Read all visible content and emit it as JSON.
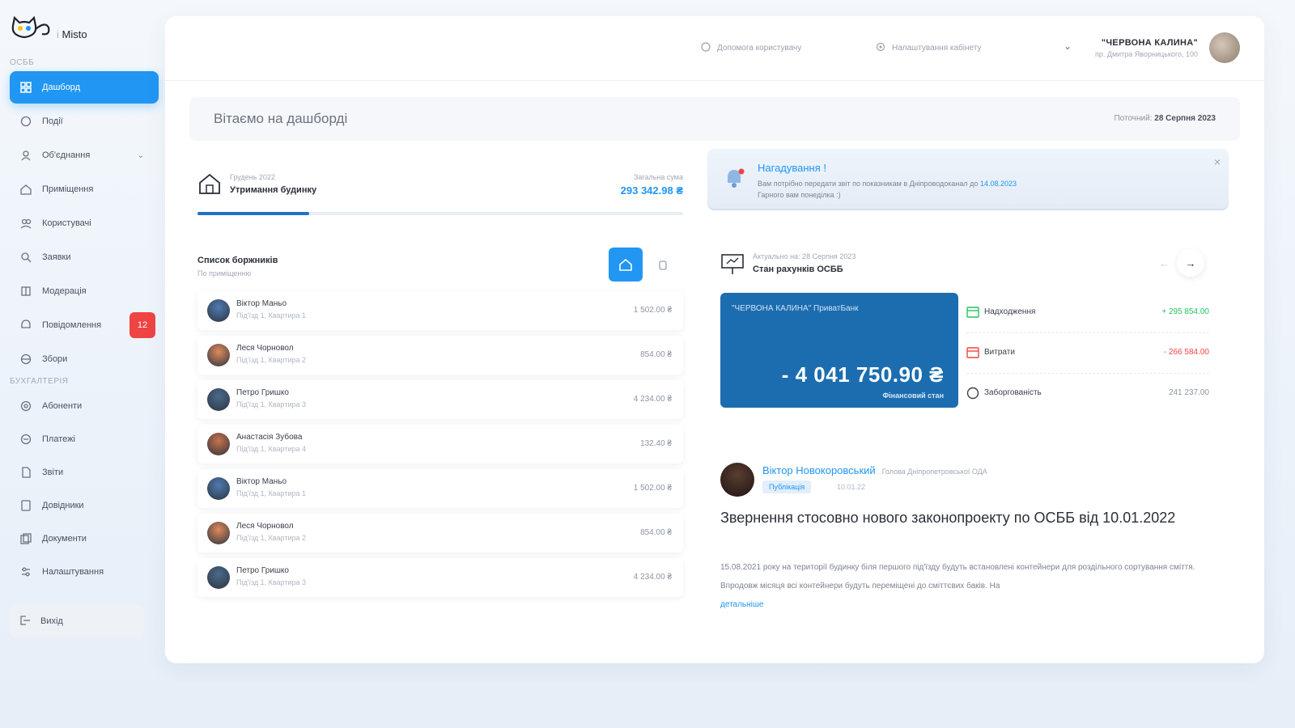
{
  "sidebar": {
    "logo_prefix": "i",
    "logo_name": "Misto",
    "section_osbb": "ОСББ",
    "section_accounting": "БУХГАЛТЕРІЯ",
    "items": [
      {
        "label": "Дашборд",
        "icon": "dashboard-icon",
        "active": true
      },
      {
        "label": "Події",
        "icon": "events-icon"
      },
      {
        "label": "Об'єднання",
        "icon": "association-icon"
      },
      {
        "label": "Приміщення",
        "icon": "premises-icon"
      },
      {
        "label": "Користувачі",
        "icon": "users-icon"
      },
      {
        "label": "Заявки",
        "icon": "requests-icon"
      },
      {
        "label": "Модерація",
        "icon": "moderation-icon"
      },
      {
        "label": "Повідомлення",
        "icon": "messages-icon",
        "badge": "12"
      },
      {
        "label": "Збори",
        "icon": "meetings-icon"
      },
      {
        "label": "Абоненти",
        "icon": "subscribers-icon"
      },
      {
        "label": "Платежі",
        "icon": "payments-icon"
      },
      {
        "label": "Звіти",
        "icon": "reports-icon"
      },
      {
        "label": "Довідники",
        "icon": "directories-icon"
      },
      {
        "label": "Документи",
        "icon": "documents-icon"
      },
      {
        "label": "Налаштування",
        "icon": "settings-icon"
      }
    ],
    "logout": "Вихід"
  },
  "topbar": {
    "help_label": "Допомога користувачу",
    "settings_label": "Налаштування кабінету",
    "user_name": "\"ЧЕРВОНА КАЛИНА\"",
    "user_sub": "пр. Дмитра Яворницького, 100"
  },
  "welcome": {
    "title": "Вітаємо на дашборді",
    "date_label": "Поточний:",
    "date_value": "28 Серпня 2023"
  },
  "budget": {
    "period": "Грудень 2022",
    "title": "Утримання будинку",
    "sum_label": "Загальна сума",
    "sum_value": "293 342.98 ₴",
    "progress": 0.23
  },
  "debtors": {
    "title": "Список боржників",
    "subtitle": "По приміщенню",
    "rows": [
      {
        "name": "Віктор Маньо",
        "apt": "Під'їзд 1, Квартира 1",
        "amount": "1 502.00 ₴",
        "color": "#4f7bb0"
      },
      {
        "name": "Леся Чорновол",
        "apt": "Під'їзд 1, Квартира 2",
        "amount": "854.00 ₴",
        "color": "#e08a5b"
      },
      {
        "name": "Петро Гришко",
        "apt": "Під'їзд 1, Квартира 3",
        "amount": "4 234.00 ₴",
        "color": "#4b6a8c"
      },
      {
        "name": "Анастасія Зубова",
        "apt": "Під'їзд 1, Квартира 4",
        "amount": "132.40 ₴",
        "color": "#c9734a"
      },
      {
        "name": "Віктор Маньо",
        "apt": "Під'їзд 1, Квартира 1",
        "amount": "1 502.00 ₴",
        "color": "#4f7bb0"
      },
      {
        "name": "Леся Чорновол",
        "apt": "Під'їзд 1, Квартира 2",
        "amount": "854.00 ₴",
        "color": "#e08a5b"
      },
      {
        "name": "Петро Гришко",
        "apt": "Під'їзд 1, Квартира 3",
        "amount": "4 234.00 ₴",
        "color": "#4b6a8c"
      }
    ]
  },
  "notice": {
    "title": "Нагадування !",
    "text": "Вам потрібно передати звіт по показникам в Дніпроводоканал до",
    "date": "14.08.2023",
    "text2": "Гарного вам понеділка :)"
  },
  "account": {
    "updated": "Актуально на: 28 Серпня 2023",
    "title": "Стан рахунків ОСББ",
    "bank_name": "\"ЧЕРВОНА КАЛИНА\" ПриватБанк",
    "balance": "- 4 041 750.90 ₴",
    "balance_label": "Фінансовий стан",
    "stats": [
      {
        "label": "Надходження",
        "value": "+ 295 854.00",
        "color": "#22c55e",
        "icon": "income-icon"
      },
      {
        "label": "Витрати",
        "value": "- 266 584.00",
        "color": "#ef4444",
        "icon": "expense-icon"
      },
      {
        "label": "Заборгованість",
        "value": "241 237.00",
        "color": "#8d94a1",
        "icon": "debt-icon"
      }
    ]
  },
  "news": {
    "author": "Віктор Новокоровський",
    "role": "Голова Дніпропетровської ОДА",
    "tag": "Публікація",
    "date": "10.01.22",
    "headline": "Звернення стосовно нового законопроекту по ОСББ від 10.01.2022",
    "body": "15.08.2021 року на території будинку біля першого під'їзду будуть встановлені контейнери для роздільного сортування сміття. Впродовж місяця всі контейнери будуть переміщені до сміттєвих баків. На",
    "more": "детальніше"
  }
}
